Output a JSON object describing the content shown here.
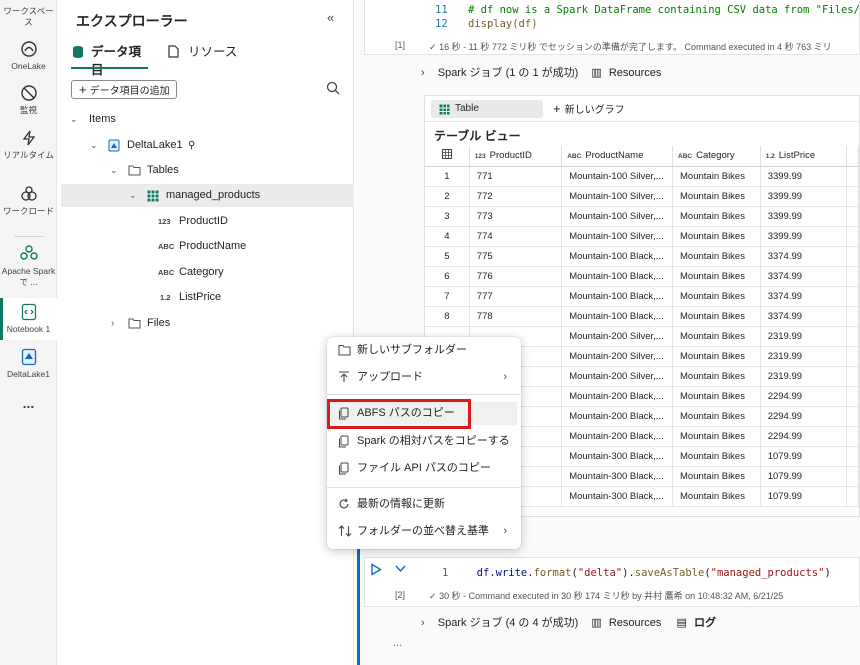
{
  "rail": {
    "items": [
      {
        "label": "ワークスペース"
      },
      {
        "label": "OneLake"
      },
      {
        "label": "監視"
      },
      {
        "label": "リアルタイム"
      },
      {
        "label": "ワークロード"
      },
      {
        "label": "Apache Spark で ..."
      },
      {
        "label": "Notebook 1"
      },
      {
        "label": "DeltaLake1"
      }
    ],
    "more": "..."
  },
  "explorer": {
    "title": "エクスプローラー",
    "tab_data": "データ項目",
    "tab_resources": "リソース",
    "add_button": "データ項目の追加",
    "tree": {
      "items": "Items",
      "lakehouse": "DeltaLake1",
      "tables": "Tables",
      "table": "managed_products",
      "columns": [
        {
          "type": "123",
          "name": "ProductID"
        },
        {
          "type": "ABC",
          "name": "ProductName"
        },
        {
          "type": "ABC",
          "name": "Category"
        },
        {
          "type": "1.2",
          "name": "ListPrice"
        }
      ],
      "files": "Files"
    }
  },
  "cell1": {
    "lines": [
      {
        "num": "11",
        "code": "# df now is a Spark DataFrame containing CSV data from \"Files/p"
      },
      {
        "num": "12",
        "code": "display(df)"
      }
    ],
    "exec_index": "[1]",
    "status": "16 秒 - 11 秒 772 ミリ秒 でセッションの準備が完了します。 Command executed in 4 秒 763 ミリ",
    "spark_jobs": "Spark ジョブ (1 の 1 が成功)",
    "resources": "Resources"
  },
  "output": {
    "table_tab": "Table",
    "new_graph": "新しいグラフ",
    "view_title": "テーブル ビュー",
    "headers": [
      {
        "type": "123",
        "name": "ProductID"
      },
      {
        "type": "ABC",
        "name": "ProductName"
      },
      {
        "type": "ABC",
        "name": "Category"
      },
      {
        "type": "1.2",
        "name": "ListPrice"
      }
    ],
    "rows": [
      [
        "1",
        "771",
        "Mountain-100 Silver,...",
        "Mountain Bikes",
        "3399.99"
      ],
      [
        "2",
        "772",
        "Mountain-100 Silver,...",
        "Mountain Bikes",
        "3399.99"
      ],
      [
        "3",
        "773",
        "Mountain-100 Silver,...",
        "Mountain Bikes",
        "3399.99"
      ],
      [
        "4",
        "774",
        "Mountain-100 Silver,...",
        "Mountain Bikes",
        "3399.99"
      ],
      [
        "5",
        "775",
        "Mountain-100 Black,...",
        "Mountain Bikes",
        "3374.99"
      ],
      [
        "6",
        "776",
        "Mountain-100 Black,...",
        "Mountain Bikes",
        "3374.99"
      ],
      [
        "7",
        "777",
        "Mountain-100 Black,...",
        "Mountain Bikes",
        "3374.99"
      ],
      [
        "8",
        "778",
        "Mountain-100 Black,...",
        "Mountain Bikes",
        "3374.99"
      ],
      [
        "",
        "",
        "Mountain-200 Silver,...",
        "Mountain Bikes",
        "2319.99"
      ],
      [
        "",
        "",
        "Mountain-200 Silver,...",
        "Mountain Bikes",
        "2319.99"
      ],
      [
        "",
        "",
        "Mountain-200 Silver,...",
        "Mountain Bikes",
        "2319.99"
      ],
      [
        "",
        "",
        "Mountain-200 Black,...",
        "Mountain Bikes",
        "2294.99"
      ],
      [
        "",
        "",
        "Mountain-200 Black,...",
        "Mountain Bikes",
        "2294.99"
      ],
      [
        "",
        "",
        "Mountain-200 Black,...",
        "Mountain Bikes",
        "2294.99"
      ],
      [
        "",
        "",
        "Mountain-300 Black,...",
        "Mountain Bikes",
        "1079.99"
      ],
      [
        "",
        "",
        "Mountain-300 Black,...",
        "Mountain Bikes",
        "1079.99"
      ],
      [
        "",
        "",
        "Mountain-300 Black,...",
        "Mountain Bikes",
        "1079.99"
      ]
    ]
  },
  "cell2": {
    "line_num": "1",
    "code_parts": [
      {
        "t": "df",
        "c": "#001080"
      },
      {
        "t": ".",
        "c": "#242424"
      },
      {
        "t": "write",
        "c": "#001080"
      },
      {
        "t": ".",
        "c": "#242424"
      },
      {
        "t": "format",
        "c": "#795e26"
      },
      {
        "t": "(",
        "c": "#242424"
      },
      {
        "t": "\"delta\"",
        "c": "#a31515"
      },
      {
        "t": ").",
        "c": "#242424"
      },
      {
        "t": "saveAsTable",
        "c": "#795e26"
      },
      {
        "t": "(",
        "c": "#242424"
      },
      {
        "t": "\"managed_products\"",
        "c": "#a31515"
      },
      {
        "t": ")",
        "c": "#242424"
      }
    ],
    "exec_index": "[2]",
    "status": "30 秒 - Command executed in 30 秒 174 ミリ秒 by 井村 鷹希 on 10:48:32 AM, 6/21/25",
    "spark_jobs": "Spark ジョブ (4 の 4 が成功)",
    "resources": "Resources",
    "log": "ログ",
    "more": "..."
  },
  "context_menu": {
    "items": [
      {
        "label": "新しいサブフォルダー",
        "icon": "folder-icon"
      },
      {
        "label": "アップロード",
        "icon": "upload-icon",
        "submenu": true
      },
      {
        "label": "ABFS パスのコピー",
        "icon": "copy-icon",
        "highlight": true
      },
      {
        "label": "Spark の相対パスをコピーする",
        "icon": "copy-icon"
      },
      {
        "label": "ファイル API パスのコピー",
        "icon": "copy-icon"
      },
      {
        "label": "最新の情報に更新",
        "icon": "refresh-icon"
      },
      {
        "label": "フォルダーの並べ替え基準",
        "icon": "sort-icon",
        "submenu": true
      }
    ]
  },
  "colors": {
    "accent": "#117865",
    "highlight_box": "#d71a1a",
    "run_blue": "#0f6cbd"
  }
}
